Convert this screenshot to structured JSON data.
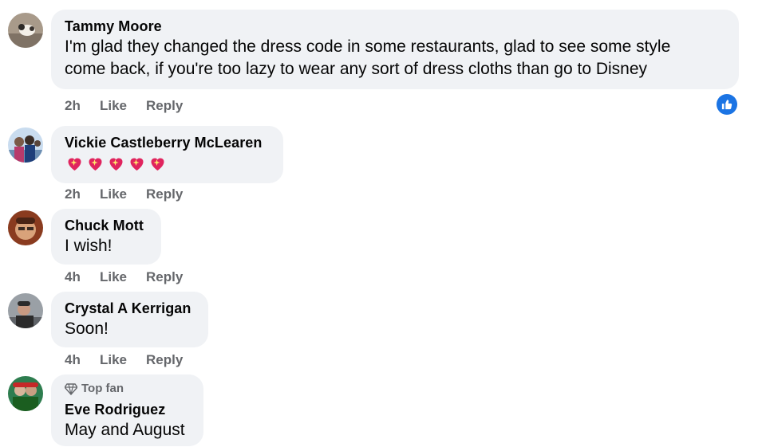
{
  "comments": [
    {
      "author": "Tammy Moore",
      "text_lines": [
        "I'm glad they changed the dress code in some restaurants, glad to see some style",
        "come back, if you're too lazy to wear any sort of dress cloths than go to Disney"
      ],
      "time": "2h",
      "like_label": "Like",
      "reply_label": "Reply",
      "reaction": "like-icon"
    },
    {
      "author": "Vickie Castleberry McLearen",
      "emoji": [
        "sparkling-heart-icon",
        "sparkling-heart-icon",
        "sparkling-heart-icon",
        "sparkling-heart-icon",
        "sparkling-heart-icon"
      ],
      "time": "2h",
      "like_label": "Like",
      "reply_label": "Reply"
    },
    {
      "author": "Chuck Mott",
      "text": "I wish!",
      "time": "4h",
      "like_label": "Like",
      "reply_label": "Reply"
    },
    {
      "author": "Crystal A Kerrigan",
      "text": "Soon!",
      "time": "4h",
      "like_label": "Like",
      "reply_label": "Reply"
    },
    {
      "badge": "Top fan",
      "badge_icon": "diamond-icon",
      "author": "Eve Rodriguez",
      "text": "May and August"
    }
  ],
  "colors": {
    "bubble": "#f0f2f5",
    "meta_text": "#65676b",
    "like_blue": "#1b74e4",
    "heart": "#e0245e"
  }
}
